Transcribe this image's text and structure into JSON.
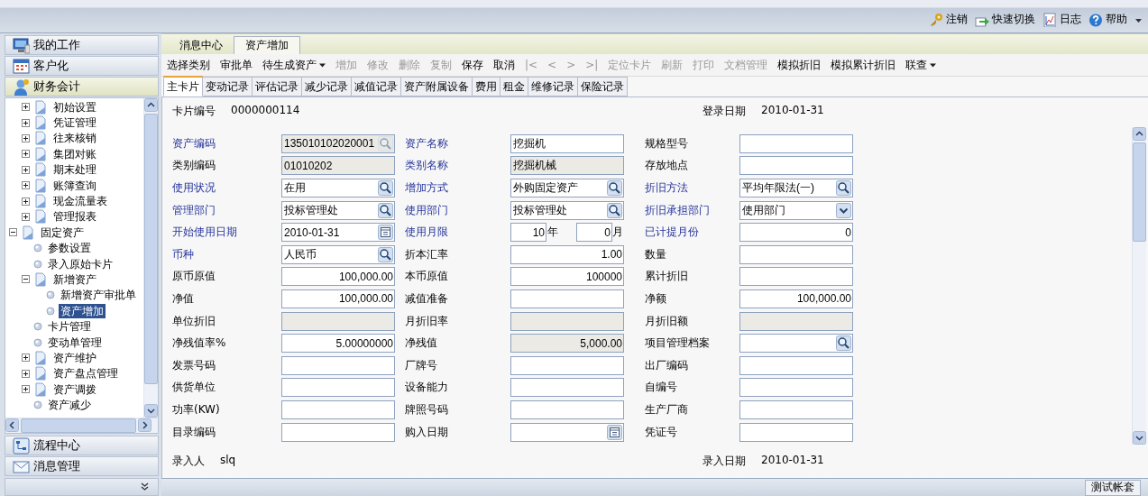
{
  "header_links": [
    {
      "label": "注销"
    },
    {
      "label": "快速切换"
    },
    {
      "label": "日志"
    },
    {
      "label": "帮助"
    }
  ],
  "nav_top": [
    {
      "label": "我的工作",
      "selected": false
    },
    {
      "label": "客户化",
      "selected": false
    },
    {
      "label": "财务会计",
      "selected": true
    }
  ],
  "tree": {
    "partial_branch": [
      {
        "label": "初始设置",
        "kind": "folder",
        "expanded": false,
        "selected": false
      },
      {
        "label": "凭证管理",
        "kind": "folder",
        "expanded": false,
        "selected": false
      },
      {
        "label": "往来核销",
        "kind": "folder",
        "expanded": false,
        "selected": false
      },
      {
        "label": "集团对账",
        "kind": "folder",
        "expanded": false,
        "selected": false
      },
      {
        "label": "期末处理",
        "kind": "folder",
        "expanded": false,
        "selected": false
      },
      {
        "label": "账簿查询",
        "kind": "folder",
        "expanded": false,
        "selected": false
      },
      {
        "label": "现金流量表",
        "kind": "folder",
        "expanded": false,
        "selected": false
      },
      {
        "label": "管理报表",
        "kind": "folder",
        "expanded": false,
        "selected": false
      }
    ],
    "items": [
      {
        "label": "固定资产",
        "kind": "folder",
        "expanded": true,
        "selected": false,
        "children": [
          {
            "label": "参数设置",
            "kind": "leaf",
            "selected": false
          },
          {
            "label": "录入原始卡片",
            "kind": "leaf",
            "selected": false
          },
          {
            "label": "新增资产",
            "kind": "folder",
            "expanded": true,
            "selected": false,
            "children": [
              {
                "label": "新增资产审批单",
                "kind": "leaf",
                "selected": false
              },
              {
                "label": "资产增加",
                "kind": "leaf",
                "selected": true
              }
            ]
          },
          {
            "label": "卡片管理",
            "kind": "leaf",
            "selected": false
          },
          {
            "label": "变动单管理",
            "kind": "leaf",
            "selected": false
          },
          {
            "label": "资产维护",
            "kind": "folder",
            "expanded": false,
            "selected": false
          },
          {
            "label": "资产盘点管理",
            "kind": "folder",
            "expanded": false,
            "selected": false
          },
          {
            "label": "资产调拨",
            "kind": "folder",
            "expanded": false,
            "selected": false
          },
          {
            "label": "资产减少",
            "kind": "leaf",
            "selected": false
          }
        ]
      }
    ]
  },
  "nav_bottom": [
    {
      "label": "流程中心",
      "selected": false
    },
    {
      "label": "消息管理",
      "selected": false
    }
  ],
  "tabs": [
    {
      "label": "消息中心",
      "selected": false
    },
    {
      "label": "资产增加",
      "selected": true
    }
  ],
  "toolbar": [
    {
      "label": "选择类别",
      "disabled": false,
      "dropdown": false
    },
    {
      "label": "审批单",
      "disabled": false,
      "dropdown": false
    },
    {
      "label": "待生成资产",
      "disabled": false,
      "dropdown": true
    },
    {
      "label": "增加",
      "disabled": true,
      "dropdown": false
    },
    {
      "label": "修改",
      "disabled": true,
      "dropdown": false
    },
    {
      "label": "删除",
      "disabled": true,
      "dropdown": false
    },
    {
      "label": "复制",
      "disabled": true,
      "dropdown": false
    },
    {
      "label": "保存",
      "disabled": false,
      "dropdown": false
    },
    {
      "label": "取消",
      "disabled": false,
      "dropdown": false
    },
    {
      "label": "|<",
      "disabled": true,
      "dropdown": false
    },
    {
      "label": "<",
      "disabled": true,
      "dropdown": false
    },
    {
      "label": ">",
      "disabled": true,
      "dropdown": false
    },
    {
      "label": ">|",
      "disabled": true,
      "dropdown": false
    },
    {
      "label": "定位卡片",
      "disabled": true,
      "dropdown": false
    },
    {
      "label": "刷新",
      "disabled": true,
      "dropdown": false
    },
    {
      "label": "打印",
      "disabled": true,
      "dropdown": false
    },
    {
      "label": "文档管理",
      "disabled": true,
      "dropdown": false
    },
    {
      "label": "模拟折旧",
      "disabled": false,
      "dropdown": false
    },
    {
      "label": "模拟累计折旧",
      "disabled": false,
      "dropdown": false
    },
    {
      "label": "联查",
      "disabled": false,
      "dropdown": true
    }
  ],
  "card_tabs": [
    {
      "label": "主卡片",
      "selected": true
    },
    {
      "label": "变动记录",
      "selected": false
    },
    {
      "label": "评估记录",
      "selected": false
    },
    {
      "label": "减少记录",
      "selected": false
    },
    {
      "label": "减值记录",
      "selected": false
    },
    {
      "label": "资产附属设备",
      "selected": false
    },
    {
      "label": "费用",
      "selected": false
    },
    {
      "label": "租金",
      "selected": false
    },
    {
      "label": "维修记录",
      "selected": false
    },
    {
      "label": "保险记录",
      "selected": false
    }
  ],
  "card": {
    "number_label": "卡片编号",
    "number": "0000000114",
    "login_date_label": "登录日期",
    "login_date": "2010-01-31",
    "rows": [
      [
        {
          "label": "资产编码",
          "required": true,
          "field": {
            "kind": "lookup",
            "value": "135010102020001",
            "readonly": true,
            "numeric": false
          }
        },
        {
          "label": "资产名称",
          "required": true,
          "field": {
            "kind": "text",
            "value": "挖掘机",
            "readonly": false,
            "numeric": false
          }
        },
        {
          "label": "规格型号",
          "required": false,
          "field": {
            "kind": "text",
            "readonly": false
          }
        }
      ],
      [
        {
          "label": "类别编码",
          "required": false,
          "field": {
            "kind": "text",
            "value": "01010202",
            "readonly": true,
            "numeric": false
          }
        },
        {
          "label": "类别名称",
          "required": true,
          "field": {
            "kind": "text",
            "value": "挖掘机械",
            "readonly": true,
            "numeric": false
          }
        },
        {
          "label": "存放地点",
          "required": false,
          "field": {
            "kind": "text",
            "readonly": false
          }
        }
      ],
      [
        {
          "label": "使用状况",
          "required": true,
          "field": {
            "kind": "lookup",
            "value": "在用",
            "readonly": false,
            "numeric": false
          }
        },
        {
          "label": "增加方式",
          "required": true,
          "field": {
            "kind": "lookup",
            "value": "外购固定资产",
            "readonly": false,
            "numeric": false
          }
        },
        {
          "label": "折旧方法",
          "required": true,
          "field": {
            "kind": "lookup",
            "value": "平均年限法(一)",
            "readonly": false,
            "numeric": false
          }
        }
      ],
      [
        {
          "label": "管理部门",
          "required": true,
          "field": {
            "kind": "lookup",
            "value": "投标管理处",
            "readonly": false,
            "numeric": false
          }
        },
        {
          "label": "使用部门",
          "required": true,
          "field": {
            "kind": "lookup",
            "value": "投标管理处",
            "readonly": false,
            "numeric": false
          }
        },
        {
          "label": "折旧承担部门",
          "required": true,
          "field": {
            "kind": "select",
            "value": "使用部门",
            "readonly": false,
            "numeric": false
          }
        }
      ],
      [
        {
          "label": "开始使用日期",
          "required": true,
          "field": {
            "kind": "date",
            "value": "2010-01-31",
            "readonly": false,
            "numeric": false
          }
        },
        {
          "label": "使用月限",
          "required": true,
          "field": {
            "kind": "period",
            "years": "10",
            "years_unit": "年",
            "months": "0",
            "months_unit": "月",
            "readonly": false,
            "numeric": true
          }
        },
        {
          "label": "已计提月份",
          "required": true,
          "field": {
            "kind": "text",
            "value": "0",
            "readonly": false,
            "numeric": true
          }
        }
      ],
      [
        {
          "label": "币种",
          "required": true,
          "field": {
            "kind": "lookup",
            "value": "人民币",
            "readonly": false,
            "numeric": false
          }
        },
        {
          "label": "折本汇率",
          "required": false,
          "field": {
            "kind": "text",
            "value": "1.00",
            "readonly": false,
            "numeric": true
          }
        },
        {
          "label": "数量",
          "required": false,
          "field": {
            "kind": "text",
            "readonly": false
          }
        }
      ],
      [
        {
          "label": "原币原值",
          "required": false,
          "field": {
            "kind": "text",
            "value": "100,000.00",
            "readonly": false,
            "numeric": true
          }
        },
        {
          "label": "本币原值",
          "required": false,
          "field": {
            "kind": "text",
            "value": "100000",
            "readonly": false,
            "numeric": true
          }
        },
        {
          "label": "累计折旧",
          "required": false,
          "field": {
            "kind": "text",
            "readonly": false
          }
        }
      ],
      [
        {
          "label": "净值",
          "required": false,
          "field": {
            "kind": "text",
            "value": "100,000.00",
            "readonly": false,
            "numeric": true
          }
        },
        {
          "label": "减值准备",
          "required": false,
          "field": {
            "kind": "text",
            "readonly": false
          }
        },
        {
          "label": "净额",
          "required": false,
          "field": {
            "kind": "text",
            "value": "100,000.00",
            "readonly": false,
            "numeric": true
          }
        }
      ],
      [
        {
          "label": "单位折旧",
          "required": false,
          "field": {
            "kind": "text",
            "readonly": true
          }
        },
        {
          "label": "月折旧率",
          "required": false,
          "field": {
            "kind": "text",
            "readonly": true
          }
        },
        {
          "label": "月折旧额",
          "required": false,
          "field": {
            "kind": "text",
            "readonly": true
          }
        }
      ],
      [
        {
          "label": "净残值率%",
          "required": false,
          "field": {
            "kind": "text",
            "value": "5.00000000",
            "readonly": false,
            "numeric": true
          }
        },
        {
          "label": "净残值",
          "required": false,
          "field": {
            "kind": "text",
            "value": "5,000.00",
            "readonly": true,
            "numeric": true
          }
        },
        {
          "label": "项目管理档案",
          "required": false,
          "field": {
            "kind": "lookup",
            "readonly": false
          }
        }
      ],
      [
        {
          "label": "发票号码",
          "required": false,
          "field": {
            "kind": "text",
            "readonly": false
          }
        },
        {
          "label": "厂牌号",
          "required": false,
          "field": {
            "kind": "text",
            "readonly": false
          }
        },
        {
          "label": "出厂编码",
          "required": false,
          "field": {
            "kind": "text",
            "readonly": false
          }
        }
      ],
      [
        {
          "label": "供货单位",
          "required": false,
          "field": {
            "kind": "text",
            "readonly": false
          }
        },
        {
          "label": "设备能力",
          "required": false,
          "field": {
            "kind": "text",
            "readonly": false
          }
        },
        {
          "label": "自编号",
          "required": false,
          "field": {
            "kind": "text",
            "readonly": false
          }
        }
      ],
      [
        {
          "label": "功率(KW)",
          "required": false,
          "field": {
            "kind": "text",
            "readonly": false
          }
        },
        {
          "label": "牌照号码",
          "required": false,
          "field": {
            "kind": "text",
            "readonly": false
          }
        },
        {
          "label": "生产厂商",
          "required": false,
          "field": {
            "kind": "text",
            "readonly": false
          }
        }
      ],
      [
        {
          "label": "目录编码",
          "required": false,
          "field": {
            "kind": "text",
            "readonly": false
          }
        },
        {
          "label": "购入日期",
          "required": false,
          "field": {
            "kind": "date",
            "readonly": false
          }
        },
        {
          "label": "凭证号",
          "required": false,
          "field": {
            "kind": "text",
            "readonly": false
          }
        }
      ]
    ],
    "entered_by_label": "录入人",
    "entered_by": "slq",
    "entry_date_label": "录入日期",
    "entry_date": "2010-01-31"
  },
  "status_bar": {
    "account": "测试帐套"
  }
}
